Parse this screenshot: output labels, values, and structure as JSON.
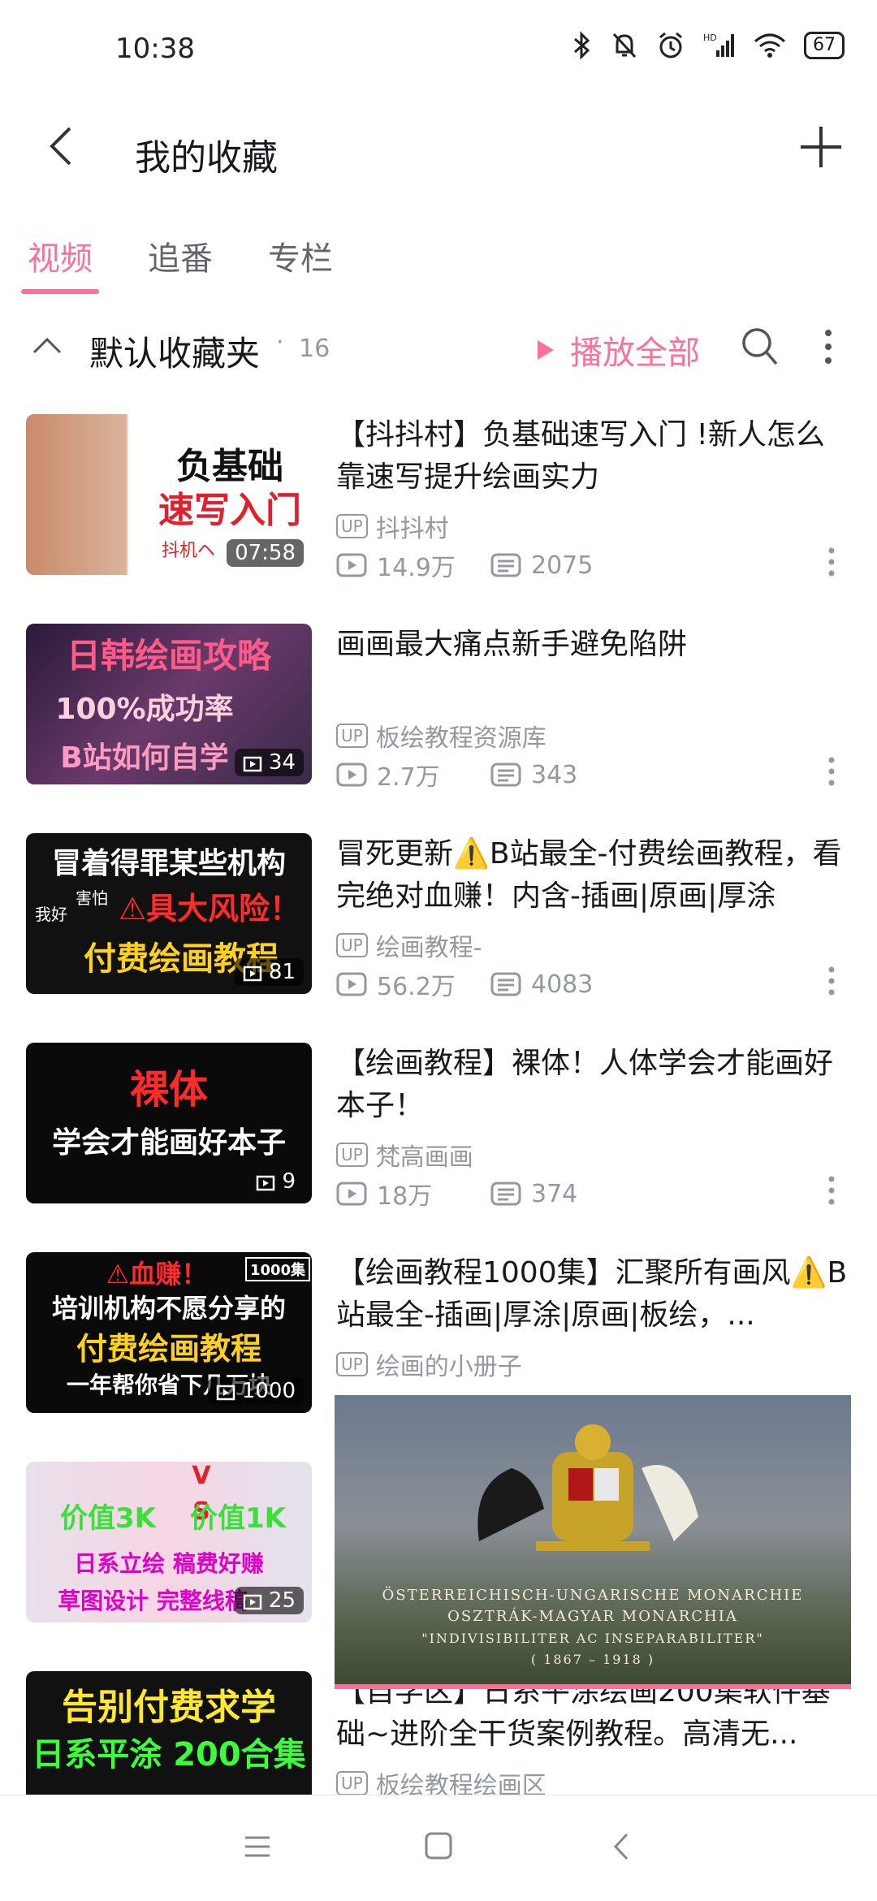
{
  "status": {
    "time": "10:38",
    "battery": "67"
  },
  "header": {
    "title": "我的收藏"
  },
  "tabs": [
    {
      "label": "视频"
    },
    {
      "label": "追番"
    },
    {
      "label": "专栏"
    }
  ],
  "folder": {
    "name": "默认收藏夹",
    "count": "16",
    "play_all": "播放全部"
  },
  "videos": [
    {
      "thumb": [
        "负基础",
        "速写入门",
        "抖机ヘ"
      ],
      "duration": "07:58",
      "title": "【抖抖村】负基础速写入门 !新人怎么靠速写提升绘画实力",
      "up": "抖抖村",
      "views": "14.9万",
      "danmaku": "2075"
    },
    {
      "thumb": [
        "日韩绘画攻略",
        "100%成功率",
        "B站如何自学"
      ],
      "duration": "34",
      "title": "画画最大痛点新手避免陷阱",
      "up": "板绘教程资源库",
      "views": "2.7万",
      "danmaku": "343"
    },
    {
      "thumb": [
        "冒着得罪某些机构",
        "⚠具大风险！",
        "付费绘画教程",
        "我好",
        "害怕"
      ],
      "duration": "81",
      "title": "冒死更新⚠️B站最全-付费绘画教程，看完绝对血赚！内含-插画|原画|厚涂",
      "up": "绘画教程-",
      "views": "56.2万",
      "danmaku": "4083"
    },
    {
      "thumb": [
        "裸体",
        "学会才能画好本子"
      ],
      "duration": "9",
      "title": "【绘画教程】裸体！人体学会才能画好本子！",
      "up": "梵高画画",
      "views": "18万",
      "danmaku": "374"
    },
    {
      "thumb": [
        "⚠血赚！",
        "培训机构不愿分享的",
        "付费绘画教程",
        "一年帮你省下几万块",
        "1000集"
      ],
      "duration": "1000",
      "title": "【绘画教程1000集】汇聚所有画风⚠️B站最全-插画|厚涂|原画|板绘，...",
      "up": "绘画的小册子",
      "views": "",
      "danmaku": ""
    },
    {
      "thumb": [
        "价值3K",
        "价值1K",
        "日系立绘 稿费好赚",
        "草图设计 完整线稿",
        "V",
        "S"
      ],
      "duration": "25",
      "title": "",
      "up": "",
      "views": "",
      "danmaku": ""
    },
    {
      "thumb": [
        "告别付费求学",
        "日系平涂 200合集"
      ],
      "duration": "",
      "title": "【自学区】日系平涂绘画200集软件基础~进阶全干货案例教程。高清无...",
      "up": "板绘教程绘画区",
      "views": "",
      "danmaku": ""
    }
  ],
  "mini_player": {
    "lines": [
      "ÖSTERREICHISCH-UNGARISCHE MONARCHIE",
      "OSZTRÁK-MAGYAR MONARCHIA",
      "\"INDIVISIBILITER AC INSEPARABILITER\"",
      "( 1867 – 1918 )"
    ]
  }
}
